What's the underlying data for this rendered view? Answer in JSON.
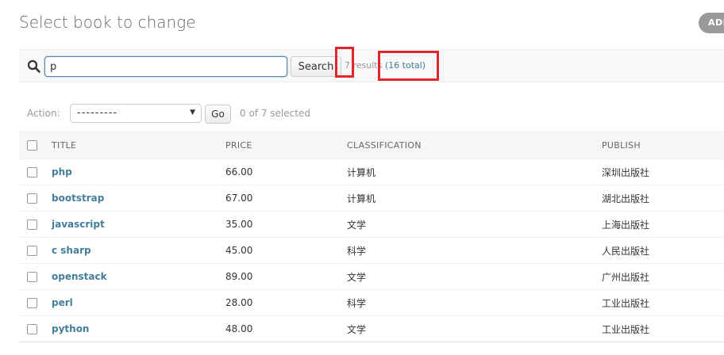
{
  "page": {
    "title": "Select book to change",
    "add_label": "ADD"
  },
  "search": {
    "value": "p",
    "button_label": "Search",
    "results_count": "7",
    "results_word": " results ",
    "total_text": "(16 total)"
  },
  "actions": {
    "label": "Action:",
    "selected_option": "---------",
    "go_label": "Go",
    "selected_counter": "0 of 7 selected"
  },
  "table": {
    "columns": [
      "TITLE",
      "PRICE",
      "CLASSIFICATION",
      "PUBLISH"
    ],
    "rows": [
      {
        "title": "php",
        "price": "66.00",
        "classification": "计算机",
        "publish": "深圳出版社"
      },
      {
        "title": "bootstrap",
        "price": "67.00",
        "classification": "计算机",
        "publish": "湖北出版社"
      },
      {
        "title": "javascript",
        "price": "35.00",
        "classification": "文学",
        "publish": "上海出版社"
      },
      {
        "title": "c sharp",
        "price": "45.00",
        "classification": "科学",
        "publish": "人民出版社"
      },
      {
        "title": "openstack",
        "price": "89.00",
        "classification": "文学",
        "publish": "广州出版社"
      },
      {
        "title": "perl",
        "price": "28.00",
        "classification": "科学",
        "publish": "工业出版社"
      },
      {
        "title": "python",
        "price": "48.00",
        "classification": "文学",
        "publish": "工业出版社"
      }
    ]
  },
  "colors": {
    "link": "#447e9b",
    "highlight": "#e0262b",
    "header_bg": "#f6f6f6"
  },
  "icons": {
    "search": "search-icon",
    "dropdown": "chevron-down-icon"
  }
}
